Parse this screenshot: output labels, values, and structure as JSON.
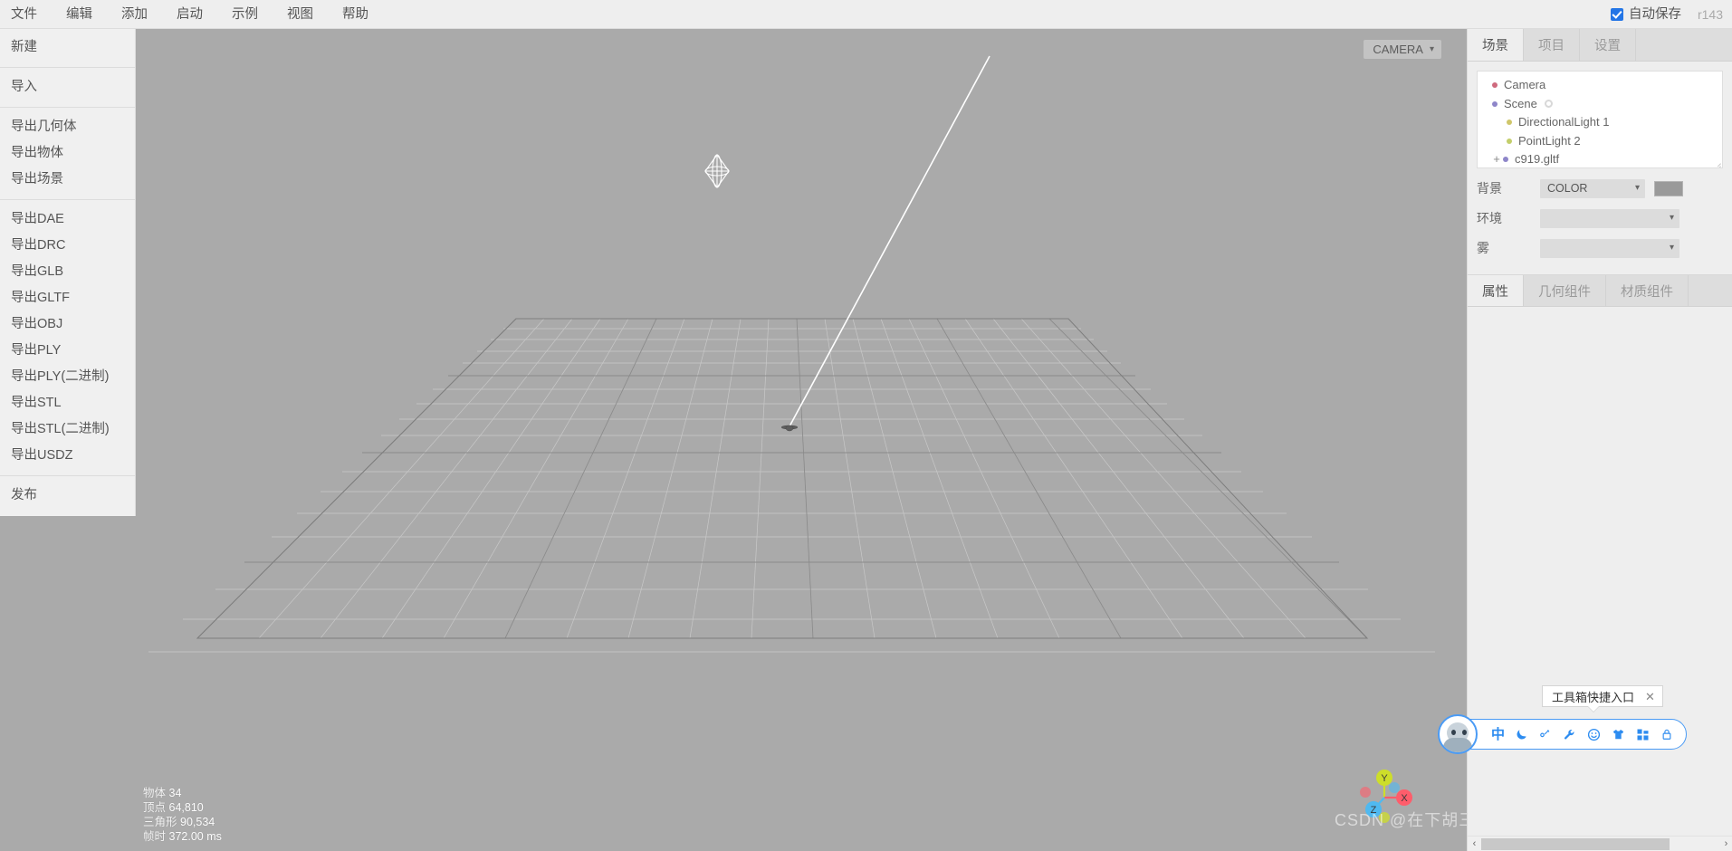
{
  "menubar": {
    "items": [
      {
        "label": "文件",
        "name": "menu-file"
      },
      {
        "label": "编辑",
        "name": "menu-edit"
      },
      {
        "label": "添加",
        "name": "menu-add"
      },
      {
        "label": "启动",
        "name": "menu-play"
      },
      {
        "label": "示例",
        "name": "menu-examples"
      },
      {
        "label": "视图",
        "name": "menu-view"
      },
      {
        "label": "帮助",
        "name": "menu-help"
      }
    ],
    "autosave_label": "自动保存",
    "autosave_checked": true,
    "version": "r143"
  },
  "file_menu": {
    "groups": [
      [
        "新建"
      ],
      [
        "导入"
      ],
      [
        "导出几何体",
        "导出物体",
        "导出场景"
      ],
      [
        "导出DAE",
        "导出DRC",
        "导出GLB",
        "导出GLTF",
        "导出OBJ",
        "导出PLY",
        "导出PLY(二进制)",
        "导出STL",
        "导出STL(二进制)",
        "导出USDZ"
      ],
      [
        "发布"
      ]
    ]
  },
  "viewport": {
    "camera_label": "CAMERA",
    "stats": [
      {
        "label": "物体",
        "value": "34"
      },
      {
        "label": "顶点",
        "value": "64,810"
      },
      {
        "label": "三角形",
        "value": "90,534"
      },
      {
        "label": "帧时",
        "value": "372.00 ms"
      }
    ],
    "axes": {
      "x": "X",
      "y": "Y",
      "z": "Z"
    },
    "watermark": "CSDN @在下胡三汉"
  },
  "sidebar": {
    "tabs": [
      {
        "label": "场景",
        "active": true
      },
      {
        "label": "项目",
        "active": false
      },
      {
        "label": "设置",
        "active": false
      }
    ],
    "outliner": [
      {
        "label": "Camera",
        "dot": "#cf6a7e",
        "indent": false,
        "expander": "",
        "ring": false
      },
      {
        "label": "Scene",
        "dot": "#8e86c9",
        "indent": false,
        "expander": "",
        "ring": true
      },
      {
        "label": "DirectionalLight 1",
        "dot": "#cfc66a",
        "indent": true,
        "expander": "",
        "ring": false
      },
      {
        "label": "PointLight 2",
        "dot": "#c3ce6a",
        "indent": true,
        "expander": "",
        "ring": false
      },
      {
        "label": "c919.gltf",
        "dot": "#8e86c9",
        "indent": false,
        "expander": "+",
        "ring": false
      }
    ],
    "properties": [
      {
        "label": "背景",
        "value": "COLOR",
        "width": "narrow",
        "swatch": "#9a9a9a"
      },
      {
        "label": "环境",
        "value": "",
        "width": "wide",
        "swatch": null
      },
      {
        "label": "雾",
        "value": "",
        "width": "wide",
        "swatch": null
      }
    ],
    "section_tabs": [
      {
        "label": "属性",
        "active": true
      },
      {
        "label": "几何组件",
        "active": false
      },
      {
        "label": "材质组件",
        "active": false
      }
    ],
    "scroll": {
      "left_arrow": "‹",
      "right_arrow": "›"
    }
  },
  "assistant": {
    "tooltip": "工具箱快捷入口",
    "close": "✕",
    "buttons": [
      {
        "name": "ime-chinese-icon",
        "glyph": "中"
      },
      {
        "name": "moon-icon",
        "glyph": "☾"
      },
      {
        "name": "eyedropper-icon",
        "glyph": "⚲"
      },
      {
        "name": "wrench-icon",
        "glyph": "🔧"
      },
      {
        "name": "smiley-icon",
        "glyph": "☺"
      },
      {
        "name": "shirt-icon",
        "glyph": "👕"
      },
      {
        "name": "toolbox-grid-icon",
        "glyph": "▞"
      },
      {
        "name": "lock-icon",
        "glyph": "🔒"
      }
    ]
  }
}
